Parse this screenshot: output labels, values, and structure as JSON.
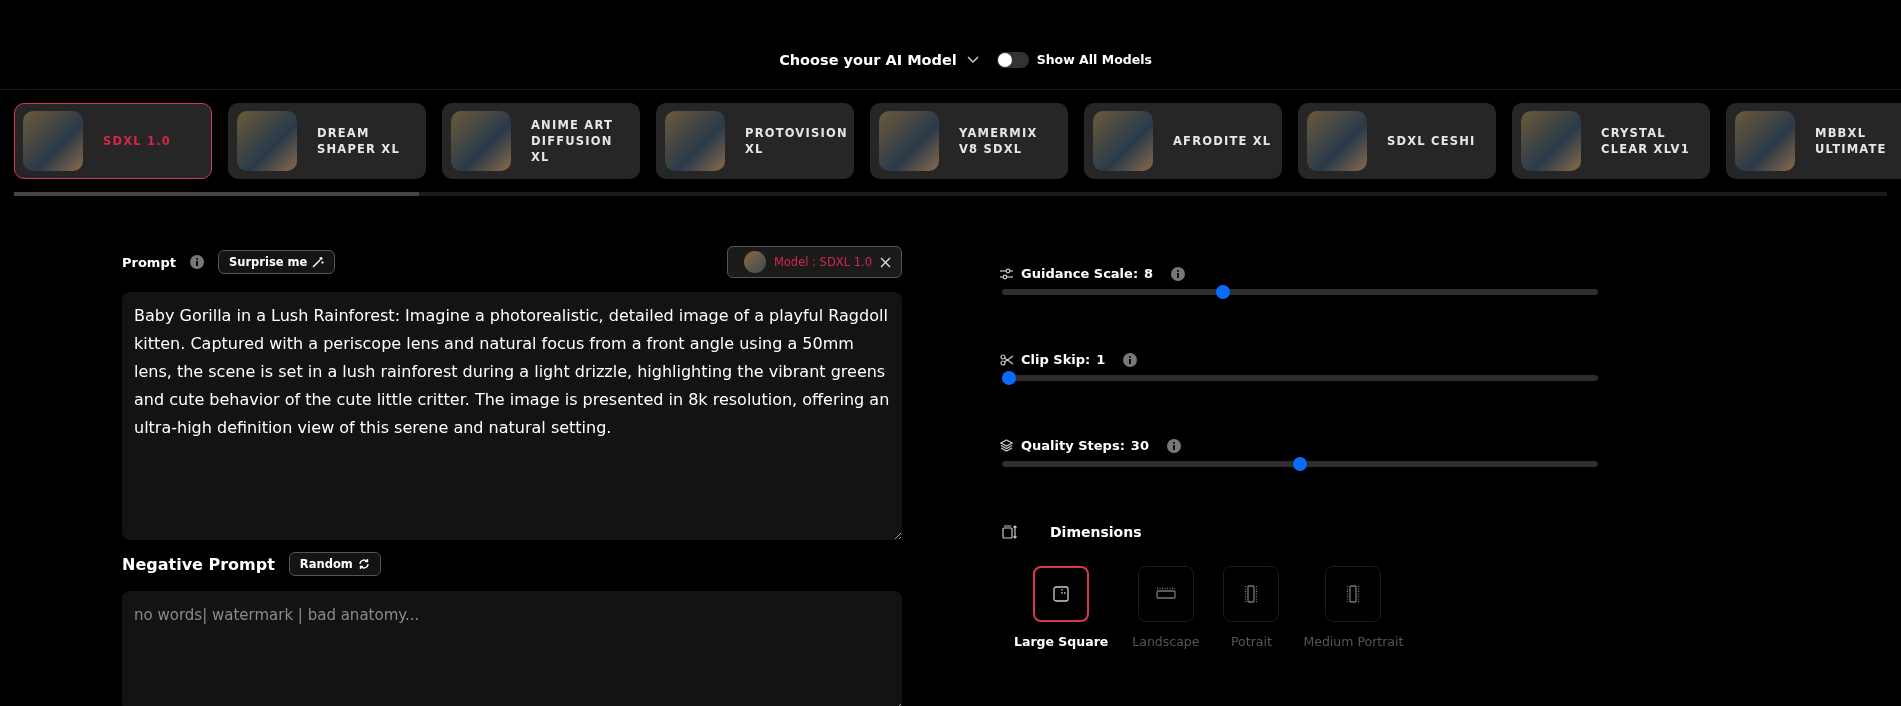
{
  "header": {
    "title": "Choose your AI Model",
    "toggle": {
      "label": "Show All Models",
      "on": false
    }
  },
  "models": [
    {
      "name": "SDXL 1.0",
      "selected": true
    },
    {
      "name": "DREAM SHAPER XL",
      "selected": false
    },
    {
      "name": "ANIME ART DIFFUSION XL",
      "selected": false
    },
    {
      "name": "PROTOVISION XL",
      "selected": false
    },
    {
      "name": "YAMERMIX V8 SDXL",
      "selected": false
    },
    {
      "name": "AFRODITE XL",
      "selected": false
    },
    {
      "name": "SDXL CESHI",
      "selected": false
    },
    {
      "name": "CRYSTAL CLEAR XLV1",
      "selected": false
    },
    {
      "name": "MBBXL ULTIMATE",
      "selected": false
    }
  ],
  "prompt": {
    "label": "Prompt",
    "surprise_button": "Surprise me",
    "model_chip": "Model : SDXL 1.0",
    "value": "Baby Gorilla in a Lush Rainforest: Imagine a photorealistic, detailed image of a playful Ragdoll kitten. Captured with a periscope lens and natural focus from a front angle using a 50mm lens, the scene is set in a lush rainforest during a light drizzle, highlighting the vibrant greens and cute behavior of the cute little critter. The image is presented in 8k resolution, offering an ultra-high definition view of this serene and natural setting."
  },
  "negative_prompt": {
    "label": "Negative Prompt",
    "random_button": "Random",
    "placeholder": "no words| watermark | bad anatomy..."
  },
  "settings": [
    {
      "kind": "guidance",
      "label": "Guidance Scale:",
      "value": "8",
      "level": 0.37
    },
    {
      "kind": "clip",
      "label": "Clip Skip:",
      "value": "1",
      "level": 0
    },
    {
      "kind": "steps",
      "label": "Quality Steps:",
      "value": "30",
      "level": 0.5
    }
  ],
  "dimensions": {
    "title": "Dimensions",
    "options": [
      {
        "kind": "square",
        "label": "Large Square",
        "selected": true
      },
      {
        "kind": "landscape",
        "label": "Landscape",
        "selected": false
      },
      {
        "kind": "portrait",
        "label": "Potrait",
        "selected": false
      },
      {
        "kind": "portrait",
        "label": "Medium Portrait",
        "selected": false
      }
    ]
  }
}
